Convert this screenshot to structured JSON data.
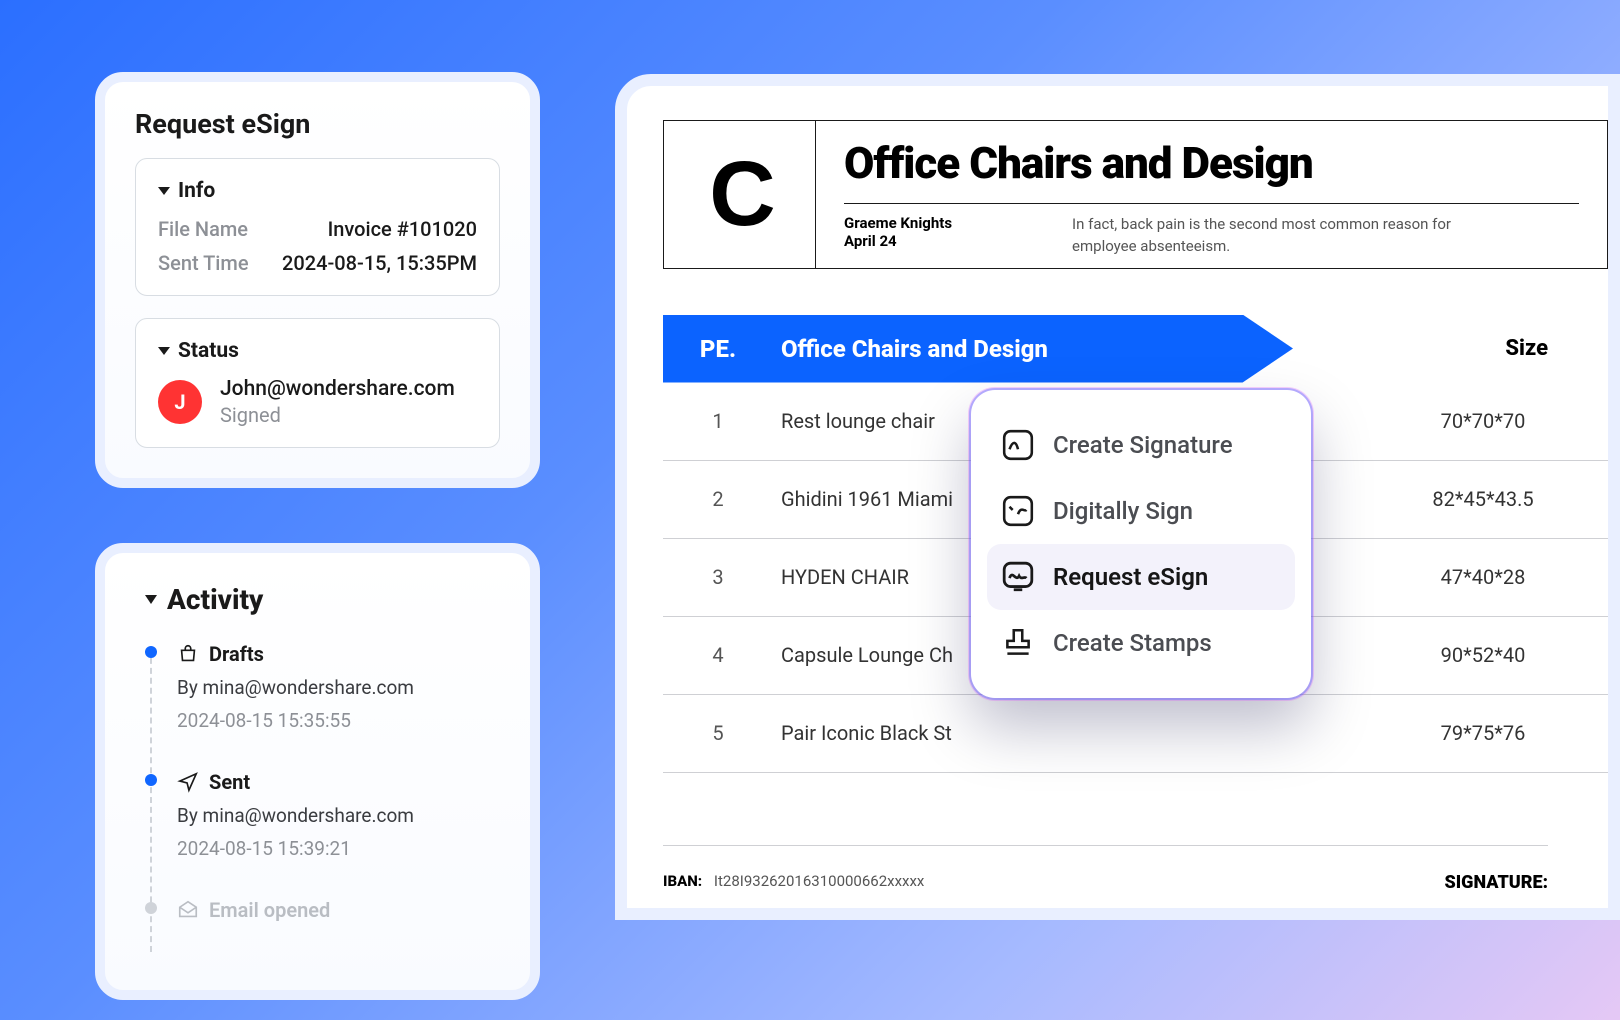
{
  "panel": {
    "title": "Request eSign",
    "info": {
      "heading": "Info",
      "file_label": "File Name",
      "file_value": "Invoice #101020",
      "sent_label": "Sent Time",
      "sent_value": "2024-08-15, 15:35PM"
    },
    "status": {
      "heading": "Status",
      "avatar_letter": "J",
      "email": "John@wondershare.com",
      "state": "Signed"
    }
  },
  "activity": {
    "title": "Activity",
    "items": [
      {
        "icon": "bag",
        "title": "Drafts",
        "by": "By mina@wondershare.com",
        "time": "2024-08-15 15:35:55"
      },
      {
        "icon": "send",
        "title": "Sent",
        "by": "By mina@wondershare.com",
        "time": "2024-08-15 15:39:21"
      },
      {
        "icon": "mail",
        "title": "Email opened",
        "by": "",
        "time": "",
        "fade": true
      }
    ]
  },
  "document": {
    "logo_letter": "C",
    "title": "Office Chairs and Design",
    "author": "Graeme Knights",
    "date": "April 24",
    "blurb": "In fact, back pain is the second most common reason for employee absenteeism.",
    "cols": {
      "pe": "PE.",
      "name": "Office Chairs and Design",
      "size": "Size"
    },
    "rows": [
      {
        "n": "1",
        "name": "Rest lounge chair",
        "size": "70*70*70"
      },
      {
        "n": "2",
        "name": "Ghidini 1961 Miami",
        "size": "82*45*43.5"
      },
      {
        "n": "3",
        "name": "HYDEN CHAIR",
        "size": "47*40*28"
      },
      {
        "n": "4",
        "name": "Capsule Lounge Ch",
        "size": "90*52*40"
      },
      {
        "n": "5",
        "name": "Pair Iconic Black St",
        "size": "79*75*76"
      }
    ],
    "iban_label": "IBAN:",
    "iban_value": "It28I93262016310000662xxxxx",
    "signature_label": "SIGNATURE:"
  },
  "context_menu": {
    "items": [
      {
        "label": "Create Signature",
        "icon": "sign-write"
      },
      {
        "label": "Digitally Sign",
        "icon": "sign-dig"
      },
      {
        "label": "Request eSign",
        "icon": "sign-req",
        "selected": true
      },
      {
        "label": "Create Stamps",
        "icon": "stamp"
      }
    ]
  }
}
